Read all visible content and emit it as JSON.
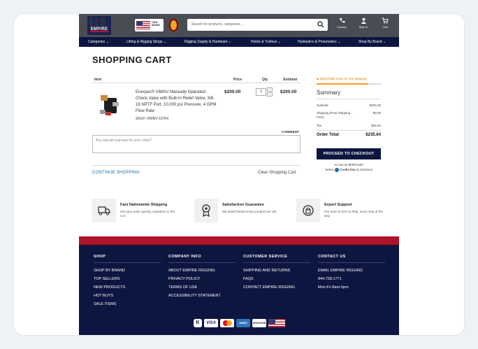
{
  "header": {
    "logo_text": "EMPIRE",
    "badge_text": "USA MADE",
    "search_placeholder": "Search for products, categories, ...",
    "icons": [
      {
        "name": "contact-icon",
        "label": "Contact"
      },
      {
        "name": "user-icon",
        "label": "Sign In"
      },
      {
        "name": "cart-icon",
        "label": "Cart"
      }
    ]
  },
  "nav": [
    "Categories ⌄",
    "Lifting & Rigging Slings ⌄",
    "Rigging Supply & Hardware ⌄",
    "Hoists & Trolleys ⌄",
    "Hydraulics & Pneumatics ⌄",
    "Shop By Brand ⌄"
  ],
  "cart": {
    "title": "SHOPPING CART",
    "columns": {
      "item": "Item",
      "price": "Price",
      "qty": "Qty",
      "subtotal": "Subtotal"
    },
    "product": {
      "name": "Enerpac® V66NV Manually Operated Check Valve with Built-In Relief Valve, 3/8-18 NPTF Port, 10,000 psi Pressure, 4 GPM Flow Rate",
      "sku": "SKU#: V66NV-10764",
      "price": "$200.00",
      "qty": "1",
      "subtotal": "$200.00"
    },
    "comment_label": "COMMENT",
    "comment_placeholder": "Any special requests for your order?",
    "continue": "CONTINUE SHOPPING",
    "clear": "Clear Shopping Cart"
  },
  "summary": {
    "promo": "Spend $50 more for free shipping",
    "promo_progress": 0.8,
    "heading": "Summary",
    "lines": [
      {
        "label": "Subtotal",
        "value": "$200.00"
      },
      {
        "label": "Shipping (Free Shipping - Free)",
        "value": "$0.00"
      },
      {
        "label": "Tax",
        "value": "$35.64"
      }
    ],
    "total_label": "Order Total",
    "total_value": "$235.64",
    "checkout": "PROCEED TO CHECKOUT",
    "as_low": "As low as $59/month",
    "select_credit": "Select",
    "credit_key": "Credit Key",
    "at_checkout": "at checkout"
  },
  "features": [
    {
      "icon": "truck-icon",
      "title": "Fast Nationwide Shipping",
      "desc": "Get your order quickly, anywhere in the U.S."
    },
    {
      "icon": "award-icon",
      "title": "Satisfaction Guarantee",
      "desc": "We stand behind every product we sell."
    },
    {
      "icon": "support-icon",
      "title": "Expert Support",
      "desc": "Our team is here to help, every step of the way."
    }
  ],
  "footer": {
    "shop": {
      "heading": "SHOP",
      "links": [
        "SHOP BY BRAND",
        "TOP SELLERS",
        "NEW PRODUCTS",
        "HOT BUYS",
        "SALE ITEMS"
      ]
    },
    "company": {
      "heading": "COMPANY INFO",
      "links": [
        "ABOUT EMPIRE RIGGING",
        "PRIVACY POLICY",
        "TERMS OF USE",
        "ACCESSIBILITY STATEMENT"
      ]
    },
    "service": {
      "heading": "CUSTOMER SERVICE",
      "links": [
        "SHIPPING AND RETURNS",
        "FAQS",
        "CONTACT EMPIRE RIGGING"
      ]
    },
    "contact": {
      "heading": "CONTACT US",
      "links": [
        "EMAIL EMPIRE RIGGING",
        "844.728.1771",
        "Mon-Fri 8am-5pm"
      ]
    },
    "payments": [
      "K",
      "VISA",
      "",
      "AMEX",
      "DISCOVER",
      ""
    ]
  },
  "colors": {
    "navy": "#0d1640",
    "red": "#b0122b",
    "accent": "#f39c12",
    "link": "#1c6ea4"
  }
}
